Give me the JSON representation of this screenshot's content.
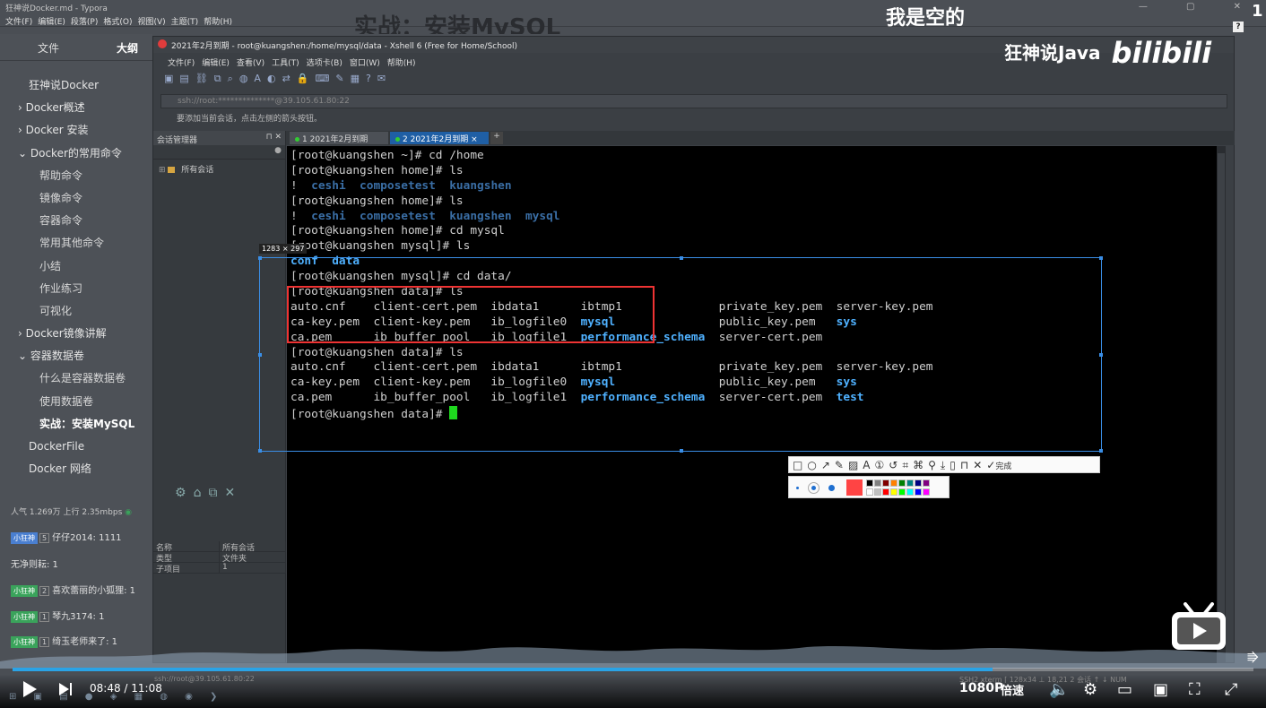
{
  "typora": {
    "title": "狂神说Docker.md - Typora",
    "menu": [
      "文件(F)",
      "编辑(E)",
      "段落(P)",
      "格式(O)",
      "视图(V)",
      "主题(T)",
      "帮助(H)"
    ],
    "bg_heading": "实战：安装MySQL",
    "window_controls": "— ▢ ✕"
  },
  "sidebar": {
    "tab_files": "文件",
    "tab_outline": "大纲",
    "outline": [
      {
        "label": "狂神说Docker",
        "level": "l1"
      },
      {
        "label": "› Docker概述",
        "level": "l1a"
      },
      {
        "label": "› Docker 安装",
        "level": "l1a"
      },
      {
        "label": "⌄ Docker的常用命令",
        "level": "l1a"
      },
      {
        "label": "帮助命令",
        "level": "l2"
      },
      {
        "label": "镜像命令",
        "level": "l2"
      },
      {
        "label": "容器命令",
        "level": "l2"
      },
      {
        "label": "常用其他命令",
        "level": "l2"
      },
      {
        "label": "小结",
        "level": "l2"
      },
      {
        "label": "作业练习",
        "level": "l2"
      },
      {
        "label": "可视化",
        "level": "l2"
      },
      {
        "label": "› Docker镜像讲解",
        "level": "l1a"
      },
      {
        "label": "⌄ 容器数据卷",
        "level": "l1a"
      },
      {
        "label": "什么是容器数据卷",
        "level": "l2"
      },
      {
        "label": "使用数据卷",
        "level": "l2"
      },
      {
        "label": "实战：安装MySQL",
        "level": "l2",
        "active": true
      },
      {
        "label": "DockerFile",
        "level": "l1"
      },
      {
        "label": "Docker 网络",
        "level": "l1"
      }
    ]
  },
  "xshell": {
    "title": "2021年2月到期 - root@kuangshen:/home/mysql/data - Xshell 6 (Free for Home/School)",
    "menu": [
      "文件(F)",
      "编辑(E)",
      "查看(V)",
      "工具(T)",
      "选项卡(B)",
      "窗口(W)",
      "帮助(H)"
    ],
    "address": "ssh://root:**************@39.105.61.80:22",
    "hint": "要添加当前会话，点击左侧的箭头按钮。",
    "session_panel_title": "会话管理器",
    "session_tree_item": "所有会话",
    "props": [
      [
        "名称",
        "所有会话"
      ],
      [
        "类型",
        "文件夹"
      ],
      [
        "子项目",
        "1"
      ]
    ],
    "tabs": [
      {
        "label": "1 2021年2月到期"
      },
      {
        "label": "2 2021年2月到期"
      }
    ],
    "status_bottom": "ssh://root@39.105.61.80:22",
    "status_right": "SSH2   xterm   ⌈ 128x34   ⊥ 18,21   2 会话   ↑ ↓   NUM"
  },
  "terminal": {
    "lines": [
      [
        {
          "t": "[root@kuangshen ~]# cd /home"
        }
      ],
      [
        {
          "t": "[root@kuangshen home]# ls"
        }
      ],
      [
        {
          "t": "!  "
        },
        {
          "t": "ceshi  composetest  kuangshen",
          "c": "dimdir"
        }
      ],
      [
        {
          "t": "[root@kuangshen home]# ls"
        }
      ],
      [
        {
          "t": "!  "
        },
        {
          "t": "ceshi  composetest  kuangshen  mysql",
          "c": "dimdir"
        }
      ],
      [
        {
          "t": "[root@kuangshen home]# cd mysql"
        }
      ],
      [
        {
          "t": "[root@kuangshen mysql]# ls"
        }
      ],
      [
        {
          "t": "conf  data",
          "c": "dir"
        }
      ],
      [
        {
          "t": "[root@kuangshen mysql]# cd data/"
        }
      ],
      [
        {
          "t": "[root@kuangshen data]# ls"
        }
      ],
      [
        {
          "t": "auto.cnf    client-cert.pem  ibdata1      ibtmp1              private_key.pem  server-key.pem"
        }
      ],
      [
        {
          "t": "ca-key.pem  client-key.pem   ib_logfile0  "
        },
        {
          "t": "mysql",
          "c": "dir"
        },
        {
          "t": "               public_key.pem   "
        },
        {
          "t": "sys",
          "c": "dir"
        }
      ],
      [
        {
          "t": "ca.pem      ib_buffer_pool   ib_logfile1  "
        },
        {
          "t": "performance_schema",
          "c": "dir"
        },
        {
          "t": "  server-cert.pem"
        }
      ],
      [
        {
          "t": "[root@kuangshen data]# ls"
        }
      ],
      [
        {
          "t": "auto.cnf    client-cert.pem  ibdata1      ibtmp1              private_key.pem  server-key.pem"
        }
      ],
      [
        {
          "t": "ca-key.pem  client-key.pem   ib_logfile0  "
        },
        {
          "t": "mysql",
          "c": "dir"
        },
        {
          "t": "               public_key.pem   "
        },
        {
          "t": "sys",
          "c": "dir"
        }
      ],
      [
        {
          "t": "ca.pem      ib_buffer_pool   ib_logfile1  "
        },
        {
          "t": "performance_schema",
          "c": "dir"
        },
        {
          "t": "  server-cert.pem  "
        },
        {
          "t": "test",
          "c": "dir"
        }
      ],
      [
        {
          "t": "[root@kuangshen data]# "
        },
        {
          "cursor": true
        }
      ]
    ]
  },
  "overlay": {
    "selection_size": "1283 × 297",
    "done_label": "完成",
    "current_color": "#ff4444",
    "palette": [
      "#000000",
      "#808080",
      "#800000",
      "#ff8000",
      "#008000",
      "#008080",
      "#000080",
      "#800080",
      "#ffffff",
      "#c0c0c0",
      "#ff0000",
      "#ffff00",
      "#00ff00",
      "#00ffff",
      "#0000ff",
      "#ff00ff"
    ]
  },
  "video": {
    "title_overlay": "我是空的",
    "page_corner": "1",
    "help": "?",
    "watermark": "狂神说Java",
    "watermark_logo": "bilibili",
    "stats": "人气 1.269万  上行 2.35mbps",
    "chat": [
      {
        "badge": "小狂神",
        "badge_color": "blue",
        "level": "5",
        "text": "仔仔2014: 1111"
      },
      {
        "text": "无净则耘: 1"
      },
      {
        "badge": "小狂神",
        "level": "2",
        "text": "喜欢蕾丽的小狐狸: 1"
      },
      {
        "badge": "小狂神",
        "level": "1",
        "text": "琴九3174: 1"
      },
      {
        "badge": "小狂神",
        "level": "1",
        "text": "绮玉老师来了: 1"
      }
    ],
    "current_time": "08:48",
    "total_time": "11:08",
    "progress": 0.79,
    "quality": "1080P",
    "speed": "倍速"
  }
}
